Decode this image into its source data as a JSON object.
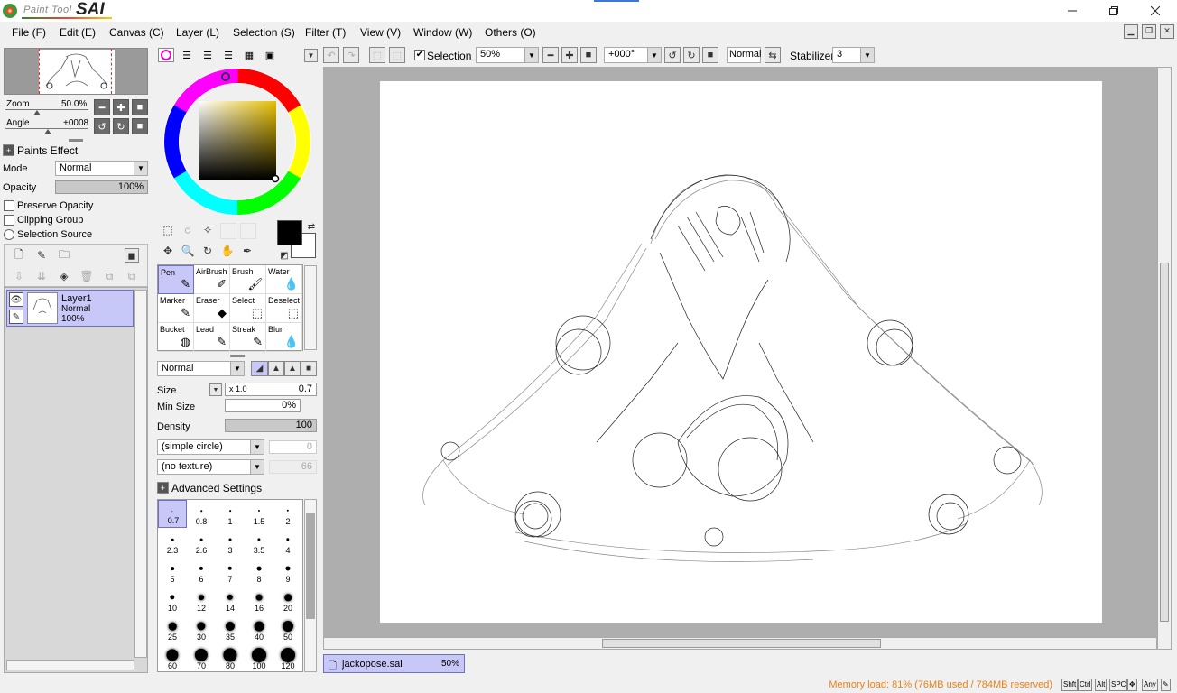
{
  "app": {
    "logo_small": "Paint Tool",
    "logo_big": "SAI"
  },
  "menu": [
    "File (F)",
    "Edit (E)",
    "Canvas (C)",
    "Layer (L)",
    "Selection (S)",
    "Filter (T)",
    "View (V)",
    "Window (W)",
    "Others (O)"
  ],
  "navigator": {
    "zoom_label": "Zoom",
    "zoom_value": "50.0%",
    "angle_label": "Angle",
    "angle_value": "+0008"
  },
  "paints_effect": {
    "header": "Paints Effect",
    "mode_label": "Mode",
    "mode_value": "Normal",
    "opacity_label": "Opacity",
    "opacity_value": "100%",
    "preserve_opacity": "Preserve Opacity",
    "clipping_group": "Clipping Group",
    "selection_source": "Selection Source"
  },
  "layer": {
    "name": "Layer1",
    "mode": "Normal",
    "opacity": "100%"
  },
  "tools": [
    {
      "name": "Pen",
      "icon": "pen-icon",
      "glyph": "✎"
    },
    {
      "name": "AirBrush",
      "icon": "airbrush-icon",
      "glyph": "✐"
    },
    {
      "name": "Brush",
      "icon": "brush-icon",
      "glyph": "🖌"
    },
    {
      "name": "Water",
      "icon": "water-icon",
      "glyph": "💧"
    },
    {
      "name": "Marker",
      "icon": "marker-icon",
      "glyph": "✎"
    },
    {
      "name": "Eraser",
      "icon": "eraser-icon",
      "glyph": "◆"
    },
    {
      "name": "Select",
      "icon": "select-icon",
      "glyph": "⬚"
    },
    {
      "name": "Deselect",
      "icon": "deselect-icon",
      "glyph": "⬚"
    },
    {
      "name": "Bucket",
      "icon": "bucket-icon",
      "glyph": "◍"
    },
    {
      "name": "Lead",
      "icon": "lead-icon",
      "glyph": "✎"
    },
    {
      "name": "Streak",
      "icon": "streak-icon",
      "glyph": "✎"
    },
    {
      "name": "Blur",
      "icon": "blur-icon",
      "glyph": "💧"
    }
  ],
  "brush": {
    "blend_mode": "Normal",
    "size_label": "Size",
    "size_multiplier": "x 1.0",
    "size_value": "0.7",
    "min_size_label": "Min Size",
    "min_size_value": "0%",
    "density_label": "Density",
    "density_value": "100",
    "shape": "(simple circle)",
    "shape_value": "0",
    "texture": "(no texture)",
    "texture_value": "66",
    "advanced": "Advanced Settings"
  },
  "brush_sizes": [
    "0.7",
    "0.8",
    "1",
    "1.5",
    "2",
    "2.3",
    "2.6",
    "3",
    "3.5",
    "4",
    "5",
    "6",
    "7",
    "8",
    "9",
    "10",
    "12",
    "14",
    "16",
    "20",
    "25",
    "30",
    "35",
    "40",
    "50",
    "60",
    "70",
    "80",
    "100",
    "120"
  ],
  "canvas_toolbar": {
    "selection_label": "Selection",
    "zoom": "50%",
    "angle": "+000°",
    "blend": "Normal",
    "stabilizer_label": "Stabilizer",
    "stabilizer_value": "3"
  },
  "file_tab": {
    "name": "jackopose.sai",
    "zoom": "50%"
  },
  "status": {
    "memory": "Memory load: 81% (76MB used / 784MB reserved)",
    "keys": [
      "Shft",
      "Ctrl",
      "Alt",
      "SPC",
      "✥",
      "Any",
      "✎"
    ]
  },
  "colors": {
    "foreground": "#000000",
    "background": "#ffffff",
    "accent": "#c8c8f8",
    "memory_text": "#e8801a"
  }
}
